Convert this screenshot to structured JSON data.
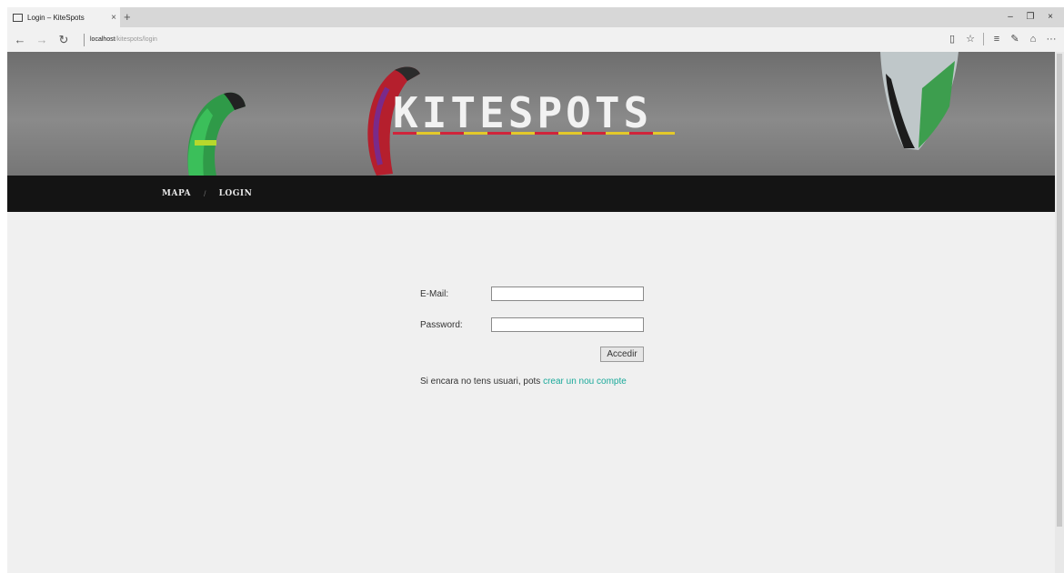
{
  "browser": {
    "tab_title": "Login – KiteSpots",
    "tab_close": "×",
    "new_tab": "+",
    "window_minimize": "–",
    "window_restore": "❐",
    "window_close": "×",
    "back": "←",
    "forward": "→",
    "refresh": "↻",
    "url_host": "localhost",
    "url_path": "/kitespots/login",
    "toolbar": {
      "reading_view": "▯",
      "favorite": "☆",
      "hub": "≡",
      "note": "✎",
      "share": "⌂",
      "more": "···"
    }
  },
  "site": {
    "logo": "KITESPOTS",
    "nav": {
      "mapa": "MAPA",
      "divider": "/",
      "login": "LOGIN"
    }
  },
  "login": {
    "email_label": "E-Mail:",
    "email_value": "",
    "password_label": "Password:",
    "password_value": "",
    "submit": "Accedir",
    "signup_text": "Si encara no tens usuari, pots ",
    "signup_link": "crear un nou compte"
  },
  "colors": {
    "link": "#1aa99a",
    "navbar": "#141414",
    "stripe_red": "#d0253b",
    "stripe_yellow": "#e3c92a"
  }
}
